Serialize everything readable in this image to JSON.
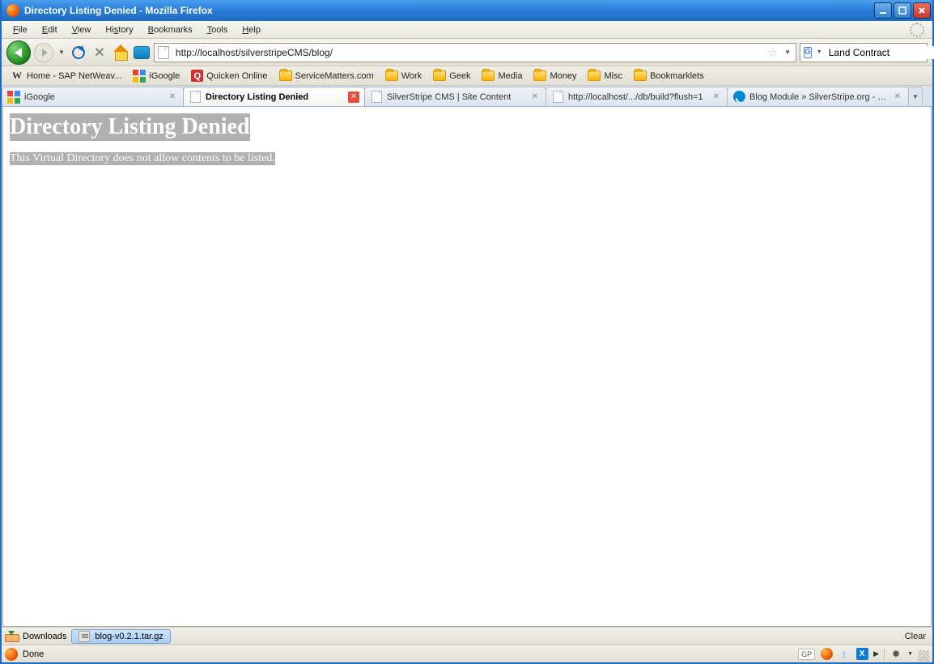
{
  "window": {
    "title": "Directory Listing Denied - Mozilla Firefox"
  },
  "menubar": {
    "items": [
      "File",
      "Edit",
      "View",
      "History",
      "Bookmarks",
      "Tools",
      "Help"
    ]
  },
  "toolbar": {
    "url": "http://localhost/silverstripeCMS/blog/",
    "search_value": "Land Contract"
  },
  "bookmarks": [
    {
      "label": "Home - SAP NetWeav...",
      "icon": "w"
    },
    {
      "label": "iGoogle",
      "icon": "goog"
    },
    {
      "label": "Quicken Online",
      "icon": "q"
    },
    {
      "label": "ServiceMatters.com",
      "icon": "folder"
    },
    {
      "label": "Work",
      "icon": "folder"
    },
    {
      "label": "Geek",
      "icon": "folder"
    },
    {
      "label": "Media",
      "icon": "folder"
    },
    {
      "label": "Money",
      "icon": "folder"
    },
    {
      "label": "Misc",
      "icon": "folder"
    },
    {
      "label": "Bookmarklets",
      "icon": "folder"
    }
  ],
  "tabs": [
    {
      "label": "iGoogle",
      "icon": "goog",
      "active": false
    },
    {
      "label": "Directory Listing Denied",
      "icon": "page",
      "active": true
    },
    {
      "label": "SilverStripe CMS | Site Content",
      "icon": "page",
      "active": false
    },
    {
      "label": "http://localhost/.../db/build?flush=1",
      "icon": "page",
      "active": false
    },
    {
      "label": "Blog Module » SilverStripe.org - O...",
      "icon": "ss",
      "active": false
    }
  ],
  "page": {
    "heading": "Directory Listing Denied",
    "body": "This Virtual Directory does not allow contents to be listed."
  },
  "downloads": {
    "label": "Downloads",
    "file": "blog-v0.2.1.tar.gz",
    "clear": "Clear"
  },
  "status": {
    "text": "Done",
    "gp": "GP"
  }
}
